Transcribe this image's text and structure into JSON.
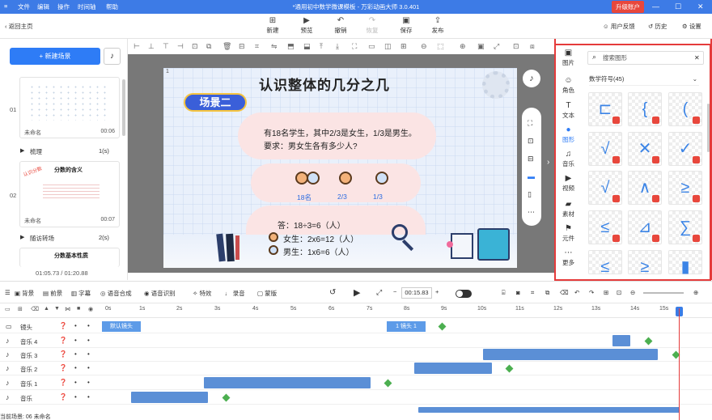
{
  "titlebar": {
    "menus": [
      "文件",
      "编辑",
      "操作",
      "时间轴",
      "帮助"
    ],
    "title": "*通用初中数学微课模板 - 万彩动画大师 3.0.401",
    "upgrade": "升级账户"
  },
  "toolbar": {
    "back": "返回主页",
    "buttons": [
      "新建",
      "预览",
      "撤销",
      "恢复",
      "保存",
      "发布"
    ],
    "right": [
      "用户反馈",
      "历史",
      "设置"
    ]
  },
  "left": {
    "new_scene": "+ 新建场景",
    "scenes": [
      {
        "num": "01",
        "name": "未命名",
        "dur": "00:06",
        "trans": "梳理",
        "trans_dur": "1(s)"
      },
      {
        "num": "02",
        "name": "未命名",
        "dur": "00:07",
        "trans": "随访转场",
        "trans_dur": "2(s)",
        "heading": "分数的含义"
      },
      {
        "heading": "分数基本性质"
      }
    ],
    "time_info": "01:05.73 / 01:20.88"
  },
  "stage": {
    "title": "认识整体的几分之几",
    "tag": "场景二",
    "question": [
      "有18名学生，其中2/3是女生，1/3是男生。",
      "要求：男女生各有多少人?"
    ],
    "labels": [
      "18名",
      "2/3",
      "1/3"
    ],
    "answer": [
      "答：18÷3=6（人）",
      "女生：2x6=12（人）",
      "男生：1x6=6（人）"
    ],
    "corner": "1"
  },
  "sidecats": [
    "图片",
    "角色",
    "文本",
    "图形",
    "音乐",
    "视频",
    "素材",
    "元件",
    "更多"
  ],
  "shapes": {
    "search_placeholder": "搜索图形",
    "category": "数学符号(45)",
    "glyphs": [
      "⊏",
      "{",
      "(",
      "√",
      "✕",
      "✓",
      "√",
      "∧",
      "≥",
      "≤",
      "⊿",
      "∑",
      "≤",
      "≥",
      "▮"
    ]
  },
  "timeline": {
    "tools": [
      "背景",
      "前景",
      "字幕",
      "语音合成",
      "语音识别",
      "特效",
      "录音",
      "蒙版"
    ],
    "time": "00:15.83",
    "ticks": [
      "0s",
      "1s",
      "2s",
      "3s",
      "4s",
      "5s",
      "6s",
      "7s",
      "8s",
      "9s",
      "10s",
      "11s",
      "12s",
      "13s",
      "14s",
      "15s"
    ],
    "tracks": [
      "镜头",
      "音乐 4",
      "音乐 3",
      "音乐 2",
      "音乐 1",
      "音乐"
    ],
    "cam_clips": [
      "默认镜头",
      "1 镜头 1"
    ]
  },
  "status": "当前场景: 06  未命名"
}
